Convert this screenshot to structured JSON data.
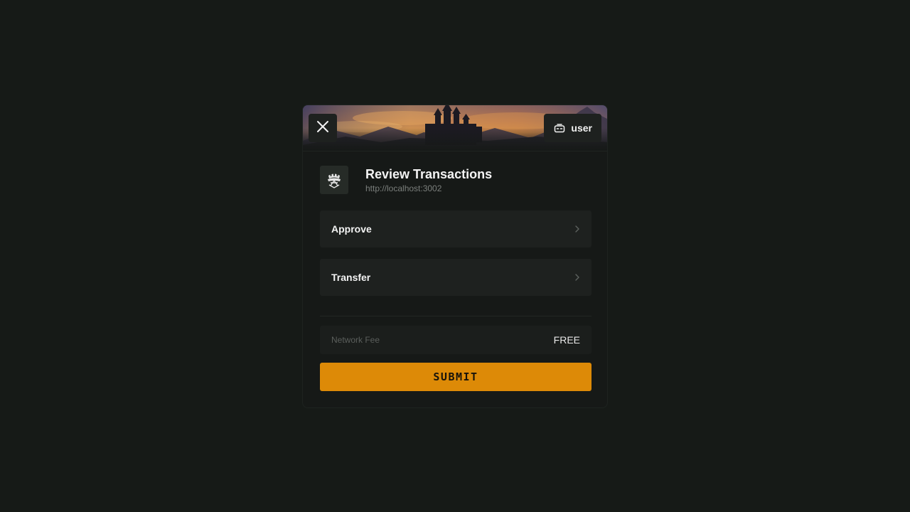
{
  "header": {
    "close_icon": "close-icon",
    "user_label": "user",
    "user_icon": "controller-icon"
  },
  "app": {
    "logo_icon": "crest-logo-icon",
    "title": "Review Transactions",
    "origin": "http://localhost:3002"
  },
  "transactions": [
    {
      "label": "Approve",
      "icon": "chevron-right-icon"
    },
    {
      "label": "Transfer",
      "icon": "chevron-right-icon"
    }
  ],
  "fee": {
    "label": "Network Fee",
    "value": "FREE"
  },
  "submit_label": "SUBMIT",
  "colors": {
    "background": "#161a17",
    "accent": "#dd8a07",
    "panel": "#1e211f"
  }
}
